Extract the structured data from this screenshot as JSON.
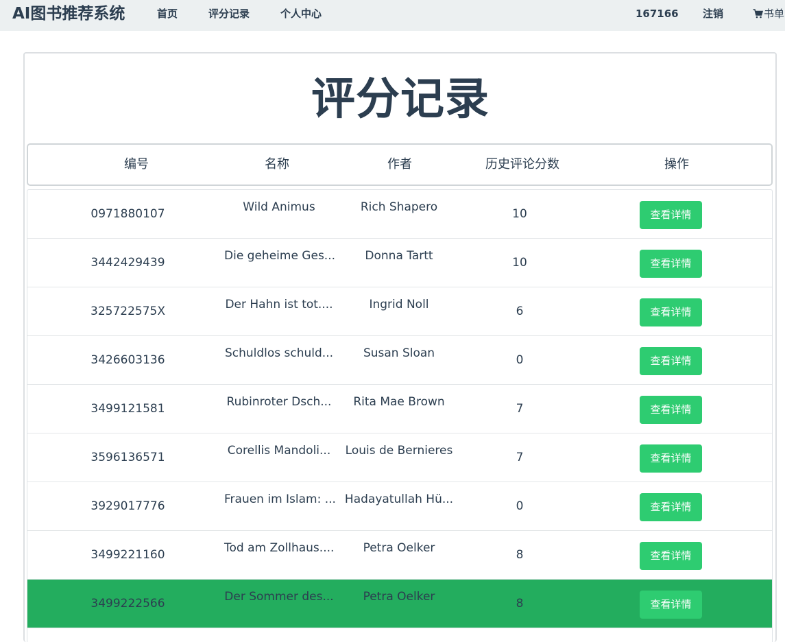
{
  "navbar": {
    "brand": "AI图书推荐系统",
    "links": [
      "首页",
      "评分记录",
      "个人中心"
    ],
    "user_id": "167166",
    "logout": "注销",
    "cart_label": "书单",
    "bg_color": "#ecf0f1"
  },
  "page": {
    "title": "评分记录"
  },
  "table": {
    "columns": [
      "编号",
      "名称",
      "作者",
      "历史评论分数",
      "操作"
    ],
    "action_label": "查看详情",
    "button_color": "#2ecc71",
    "selected_row_color": "#23ad5e",
    "rows": [
      {
        "id": "0971880107",
        "name": "Wild Animus",
        "author": "Rich Shapero",
        "score": "10"
      },
      {
        "id": "3442429439",
        "name": "Die geheime Ges...",
        "author": "Donna Tartt",
        "score": "10"
      },
      {
        "id": "325722575X",
        "name": "Der Hahn ist tot....",
        "author": "Ingrid Noll",
        "score": "6"
      },
      {
        "id": "3426603136",
        "name": "Schuldlos schuld...",
        "author": "Susan Sloan",
        "score": "0"
      },
      {
        "id": "3499121581",
        "name": "Rubinroter Dsch...",
        "author": "Rita Mae Brown",
        "score": "7"
      },
      {
        "id": "3596136571",
        "name": "Corellis Mandoli...",
        "author": "Louis de Bernieres",
        "score": "7"
      },
      {
        "id": "3929017776",
        "name": "Frauen im Islam: ...",
        "author": "Hadayatullah Hü...",
        "score": "0"
      },
      {
        "id": "3499221160",
        "name": "Tod am Zollhaus....",
        "author": "Petra Oelker",
        "score": "8"
      },
      {
        "id": "3499222566",
        "name": "Der Sommer des...",
        "author": "Petra Oelker",
        "score": "8",
        "selected": true
      }
    ]
  }
}
